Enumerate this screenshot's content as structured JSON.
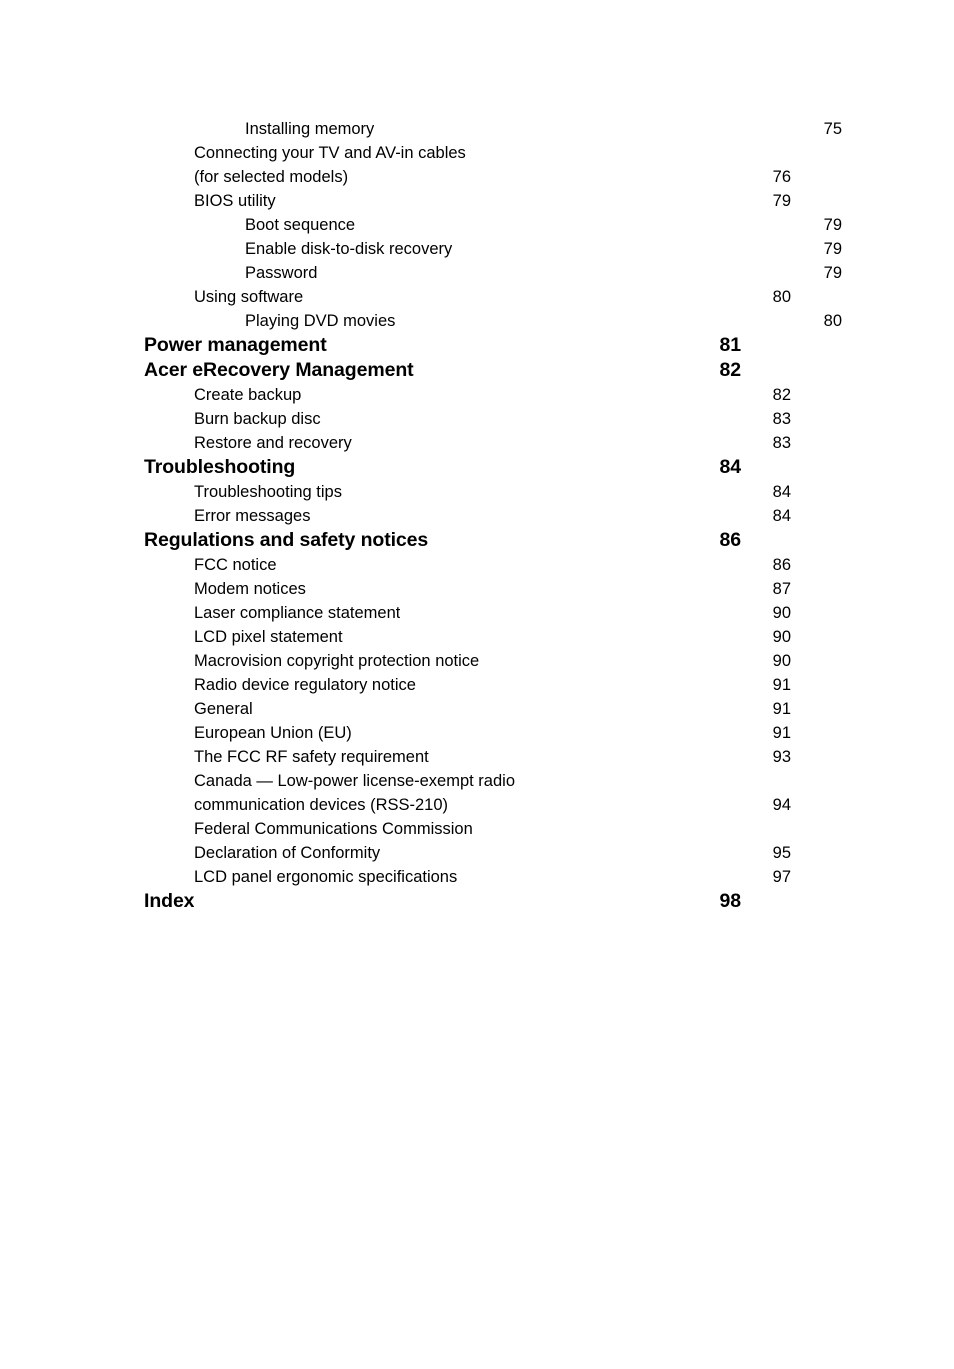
{
  "document": {
    "type": "table-of-contents",
    "background_color": "#ffffff",
    "text_color": "#000000"
  },
  "toc": {
    "entries": [
      {
        "level": 2,
        "title": "Installing memory",
        "page": "75"
      },
      {
        "level": 1,
        "title": "Connecting your TV and AV-in cables",
        "page": ""
      },
      {
        "level": 1,
        "title": "(for selected models)",
        "page": "76"
      },
      {
        "level": 1,
        "title": "BIOS utility",
        "page": "79"
      },
      {
        "level": 2,
        "title": "Boot sequence",
        "page": "79"
      },
      {
        "level": 2,
        "title": "Enable disk-to-disk recovery",
        "page": "79"
      },
      {
        "level": 2,
        "title": "Password",
        "page": "79"
      },
      {
        "level": 1,
        "title": "Using software",
        "page": "80"
      },
      {
        "level": 2,
        "title": "Playing DVD movies",
        "page": "80"
      },
      {
        "level": 0,
        "title": "Power management",
        "page": "81"
      },
      {
        "level": 0,
        "title": "Acer eRecovery Management",
        "page": "82"
      },
      {
        "level": 1,
        "title": "Create backup",
        "page": "82"
      },
      {
        "level": 1,
        "title": "Burn backup disc",
        "page": "83"
      },
      {
        "level": 1,
        "title": "Restore and recovery",
        "page": "83"
      },
      {
        "level": 0,
        "title": "Troubleshooting",
        "page": "84"
      },
      {
        "level": 1,
        "title": "Troubleshooting tips",
        "page": "84"
      },
      {
        "level": 1,
        "title": "Error messages",
        "page": "84"
      },
      {
        "level": 0,
        "title": "Regulations and safety notices",
        "page": "86"
      },
      {
        "level": 1,
        "title": "FCC notice",
        "page": "86"
      },
      {
        "level": 1,
        "title": "Modem notices",
        "page": "87"
      },
      {
        "level": 1,
        "title": "Laser compliance statement",
        "page": "90"
      },
      {
        "level": 1,
        "title": "LCD pixel statement",
        "page": "90"
      },
      {
        "level": 1,
        "title": "Macrovision copyright protection notice",
        "page": "90"
      },
      {
        "level": 1,
        "title": "Radio device regulatory notice",
        "page": "91"
      },
      {
        "level": 1,
        "title": "General",
        "page": "91"
      },
      {
        "level": 1,
        "title": "European Union (EU)",
        "page": "91"
      },
      {
        "level": 1,
        "title": "The FCC RF safety requirement",
        "page": "93"
      },
      {
        "level": 1,
        "title": "Canada — Low-power license-exempt radio",
        "page": ""
      },
      {
        "level": 1,
        "title": "communication devices (RSS-210)",
        "page": "94"
      },
      {
        "level": 1,
        "title": "Federal Communications Commission",
        "page": ""
      },
      {
        "level": 1,
        "title": "Declaration of Conformity",
        "page": "95"
      },
      {
        "level": 1,
        "title": "LCD panel ergonomic specifications",
        "page": "97"
      },
      {
        "level": 0,
        "title": "Index",
        "page": "98"
      }
    ]
  }
}
